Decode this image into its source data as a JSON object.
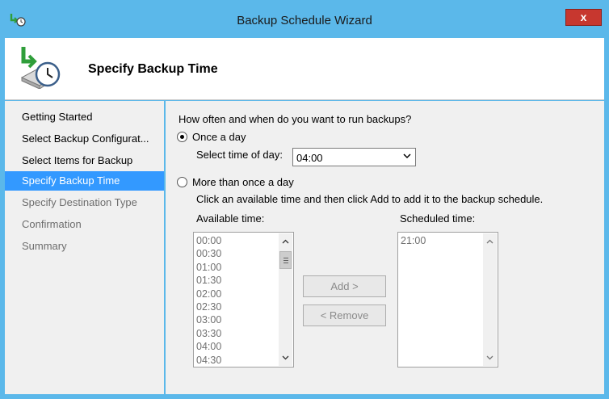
{
  "window": {
    "title": "Backup Schedule Wizard",
    "close_label": "x"
  },
  "header": {
    "title": "Specify Backup Time"
  },
  "nav": {
    "items": [
      {
        "label": "Getting Started",
        "state": "normal"
      },
      {
        "label": "Select Backup Configurat...",
        "state": "normal"
      },
      {
        "label": "Select Items for Backup",
        "state": "normal"
      },
      {
        "label": "Specify Backup Time",
        "state": "active"
      },
      {
        "label": "Specify Destination Type",
        "state": "disabled"
      },
      {
        "label": "Confirmation",
        "state": "disabled"
      },
      {
        "label": "Summary",
        "state": "disabled"
      }
    ]
  },
  "content": {
    "question": "How often and when do you want to run backups?",
    "once_a_day": {
      "label": "Once a day",
      "checked": true,
      "time_label": "Select time of day:",
      "time_value": "04:00"
    },
    "more_than_once": {
      "label": "More than once a day",
      "checked": false,
      "instruction": "Click an available time and then click Add to add it to the backup schedule.",
      "available_label": "Available time:",
      "scheduled_label": "Scheduled time:",
      "available_times": [
        "00:00",
        "00:30",
        "01:00",
        "01:30",
        "02:00",
        "02:30",
        "03:00",
        "03:30",
        "04:00",
        "04:30"
      ],
      "scheduled_times": [
        "21:00"
      ],
      "add_label": "Add >",
      "remove_label": "< Remove"
    }
  },
  "colors": {
    "frame": "#5bb8ea",
    "nav_active": "#3399ff",
    "close": "#c7372f"
  }
}
